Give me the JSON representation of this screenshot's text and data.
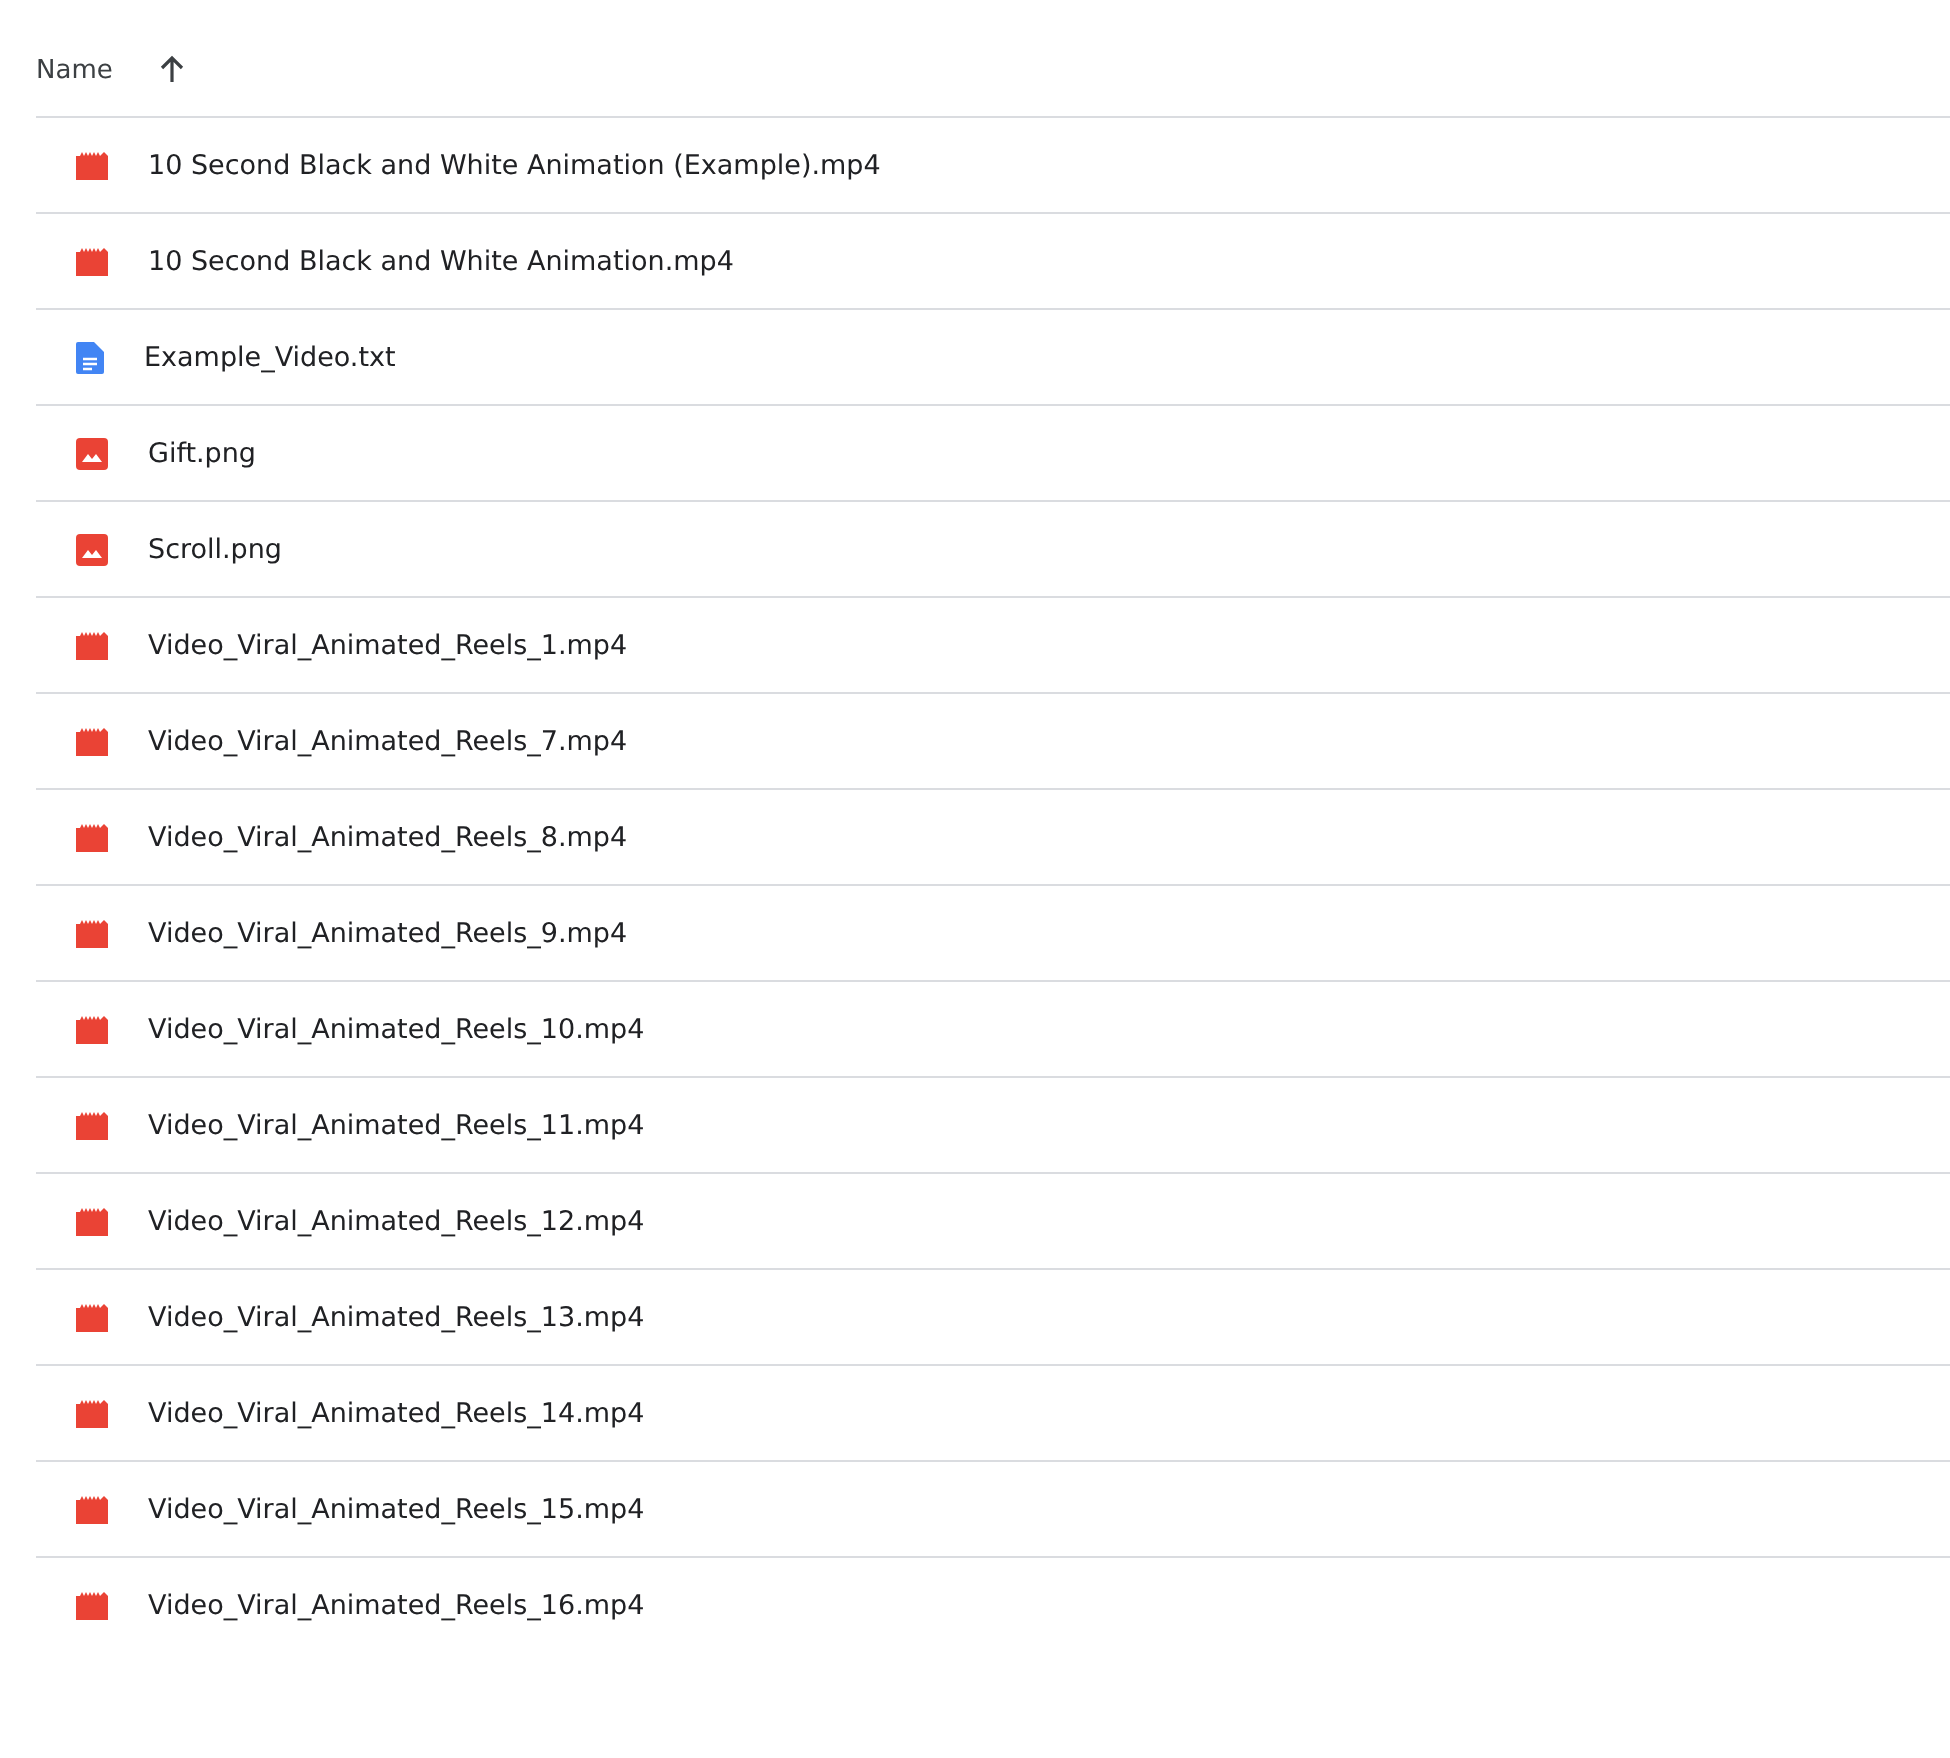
{
  "header": {
    "label": "Name",
    "sort_ascending": true
  },
  "files": [
    {
      "name": "10 Second Black and White Animation (Example).mp4",
      "kind": "video"
    },
    {
      "name": "10 Second Black and White Animation.mp4",
      "kind": "video"
    },
    {
      "name": "Example_Video.txt",
      "kind": "document"
    },
    {
      "name": "Gift.png",
      "kind": "image"
    },
    {
      "name": "Scroll.png",
      "kind": "image"
    },
    {
      "name": "Video_Viral_Animated_Reels_1.mp4",
      "kind": "video"
    },
    {
      "name": "Video_Viral_Animated_Reels_7.mp4",
      "kind": "video"
    },
    {
      "name": "Video_Viral_Animated_Reels_8.mp4",
      "kind": "video"
    },
    {
      "name": "Video_Viral_Animated_Reels_9.mp4",
      "kind": "video"
    },
    {
      "name": "Video_Viral_Animated_Reels_10.mp4",
      "kind": "video"
    },
    {
      "name": "Video_Viral_Animated_Reels_11.mp4",
      "kind": "video"
    },
    {
      "name": "Video_Viral_Animated_Reels_12.mp4",
      "kind": "video"
    },
    {
      "name": "Video_Viral_Animated_Reels_13.mp4",
      "kind": "video"
    },
    {
      "name": "Video_Viral_Animated_Reels_14.mp4",
      "kind": "video"
    },
    {
      "name": "Video_Viral_Animated_Reels_15.mp4",
      "kind": "video"
    },
    {
      "name": "Video_Viral_Animated_Reels_16.mp4",
      "kind": "video"
    }
  ]
}
